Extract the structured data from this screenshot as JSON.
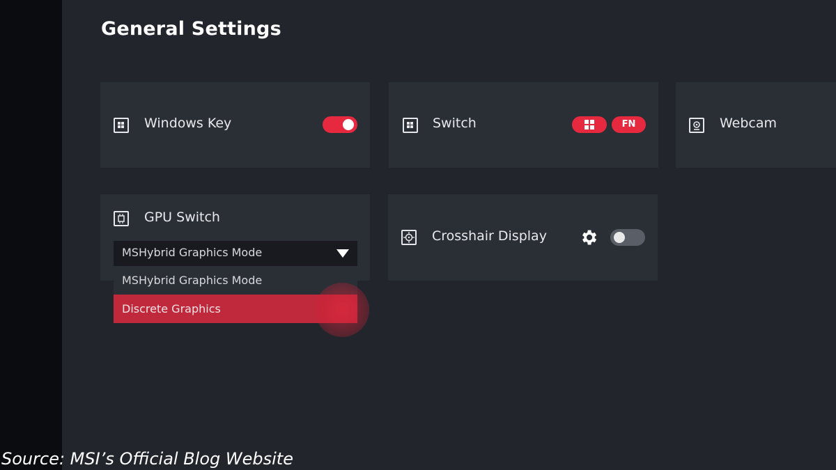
{
  "page": {
    "title": "General Settings"
  },
  "cards": {
    "windows_key": {
      "label": "Windows Key",
      "toggle_on": true
    },
    "switch": {
      "label": "Switch",
      "pill_fn": "FN"
    },
    "webcam": {
      "label": "Webcam"
    },
    "gpu_switch": {
      "label": "GPU Switch",
      "selected_value": "MSHybrid Graphics Mode",
      "options": [
        "MSHybrid Graphics Mode",
        "Discrete Graphics"
      ],
      "highlighted_option": "Discrete Graphics"
    },
    "crosshair": {
      "label": "Crosshair Display",
      "toggle_on": false
    }
  },
  "caption": "Source: MSI’s Official Blog Website",
  "colors": {
    "accent": "#e6293f",
    "background": "#22252c",
    "card": "#2a2e35",
    "sidebar": "#0b0c10"
  }
}
